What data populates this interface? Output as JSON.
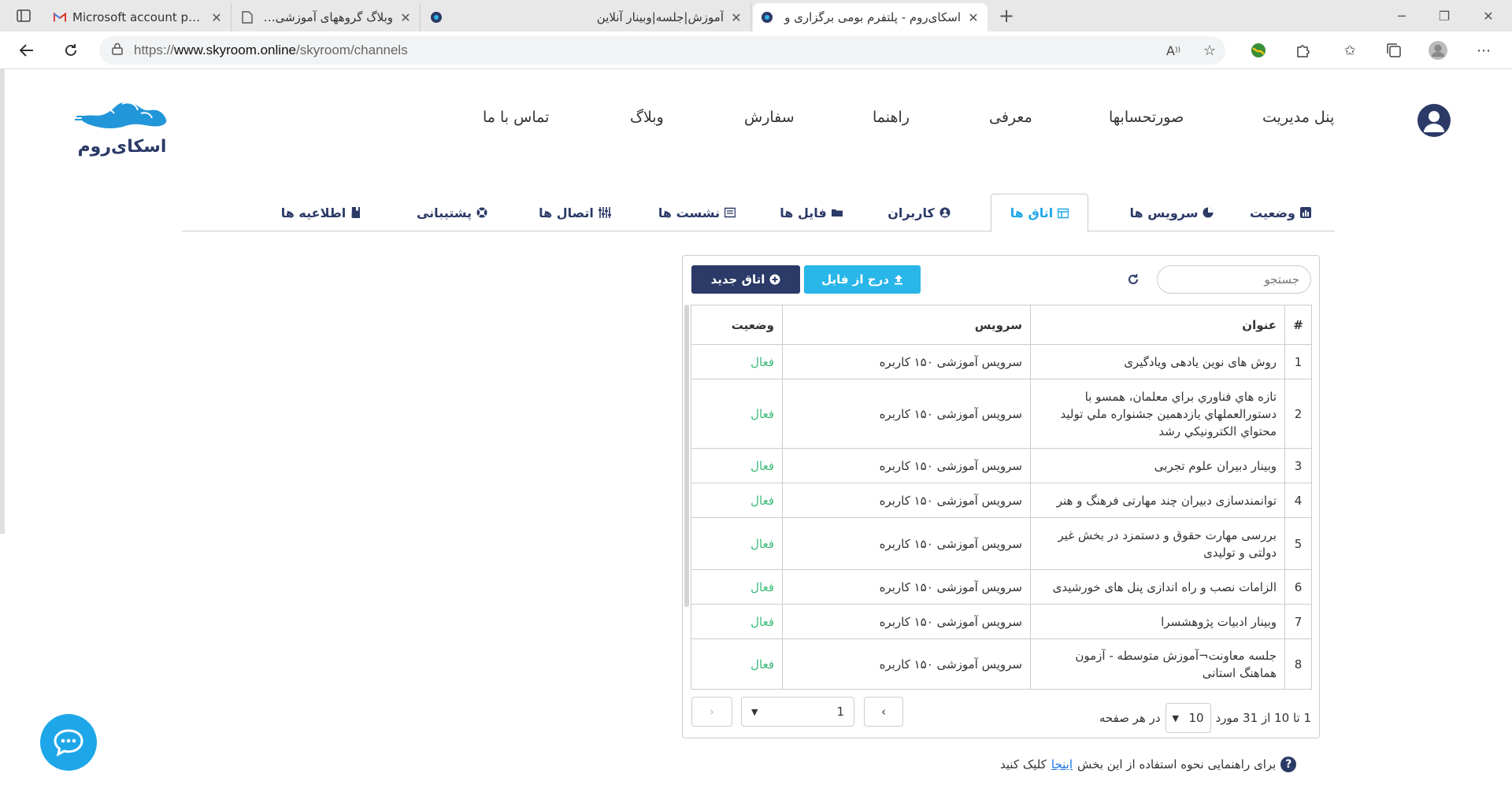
{
  "browser": {
    "tabs": [
      {
        "title": "Microsoft account password rese"
      },
      {
        "title": "وبلاگ گروههای آموزشی استان کردس"
      },
      {
        "title": "آموزش|جلسه|وبینار آنلاین"
      },
      {
        "title": "اسکای‌روم - پلتفرم بومی برگزاری و"
      }
    ],
    "url_prefix": "https://",
    "url_host": "www.skyroom.online",
    "url_path": "/skyroom/channels",
    "new_tab_label": "+"
  },
  "header": {
    "logo_text": "اسکای‌روم",
    "nav": [
      "پنل مدیریت",
      "صورتحسابها",
      "معرفی",
      "راهنما",
      "سفارش",
      "وبلاگ",
      "تماس با ما"
    ]
  },
  "tabs": [
    {
      "label": "وضعیت"
    },
    {
      "label": "سرویس ها"
    },
    {
      "label": "اتاق ها"
    },
    {
      "label": "کاربران"
    },
    {
      "label": "فایل ها"
    },
    {
      "label": "نشست ها"
    },
    {
      "label": "اتصال ها"
    },
    {
      "label": "پشتیبانی"
    },
    {
      "label": "اطلاعیه ها"
    }
  ],
  "toolbar": {
    "search_placeholder": "جستجو",
    "upload_label": "درج از فایل",
    "new_room_label": "اتاق جدید"
  },
  "table": {
    "headers": {
      "num": "#",
      "title": "عنوان",
      "service": "سرویس",
      "status": "وضعیت"
    },
    "rows": [
      {
        "num": "1",
        "title": "روش های نوین یادهی ویادگیری",
        "service": "سرویس آموزشی ۱۵۰ کاربره",
        "status": "فعال"
      },
      {
        "num": "2",
        "title": "تازه هاي فناوري براي معلمان، همسو با دستورالعملهاي يازدهمين جشنواره ملي توليد محتواي الكترونيكي رشد",
        "service": "سرویس آموزشی ۱۵۰ کاربره",
        "status": "فعال"
      },
      {
        "num": "3",
        "title": "وبینار دبیران علوم تجربی",
        "service": "سرویس آموزشی ۱۵۰ کاربره",
        "status": "فعال"
      },
      {
        "num": "4",
        "title": "توانمندسازی دبیران چند مهارتی فرهنگ و هنر",
        "service": "سرویس آموزشی ۱۵۰ کاربره",
        "status": "فعال"
      },
      {
        "num": "5",
        "title": "بررسی مهارت حقوق و دستمزد در بخش غیر دولتی و تولیدی",
        "service": "سرویس آموزشی ۱۵۰ کاربره",
        "status": "فعال"
      },
      {
        "num": "6",
        "title": "الزامات نصب و راه اندازی پنل های خورشیدی",
        "service": "سرویس آموزشی ۱۵۰ کاربره",
        "status": "فعال"
      },
      {
        "num": "7",
        "title": "وبینار ادبیات پژوهشسرا",
        "service": "سرویس آموزشی ۱۵۰ کاربره",
        "status": "فعال"
      },
      {
        "num": "8",
        "title": "جلسه معاونت¬آموزش متوسطه - آزمون هماهنگ استانی",
        "service": "سرویس آموزشی ۱۵۰ کاربره",
        "status": "فعال"
      }
    ]
  },
  "pagination": {
    "range_text": "1 تا 10 از 31 مورد",
    "per_page": "10",
    "per_page_suffix": "در هر صفحه",
    "current_page": "1"
  },
  "help": {
    "before": "برای راهنمایی نحوه استفاده از این بخش",
    "link": "اینجا",
    "after": "کلیک کنید"
  },
  "colors": {
    "brand": "#2b3a67",
    "accent": "#29b6e8",
    "active": "#3dbb7a"
  }
}
